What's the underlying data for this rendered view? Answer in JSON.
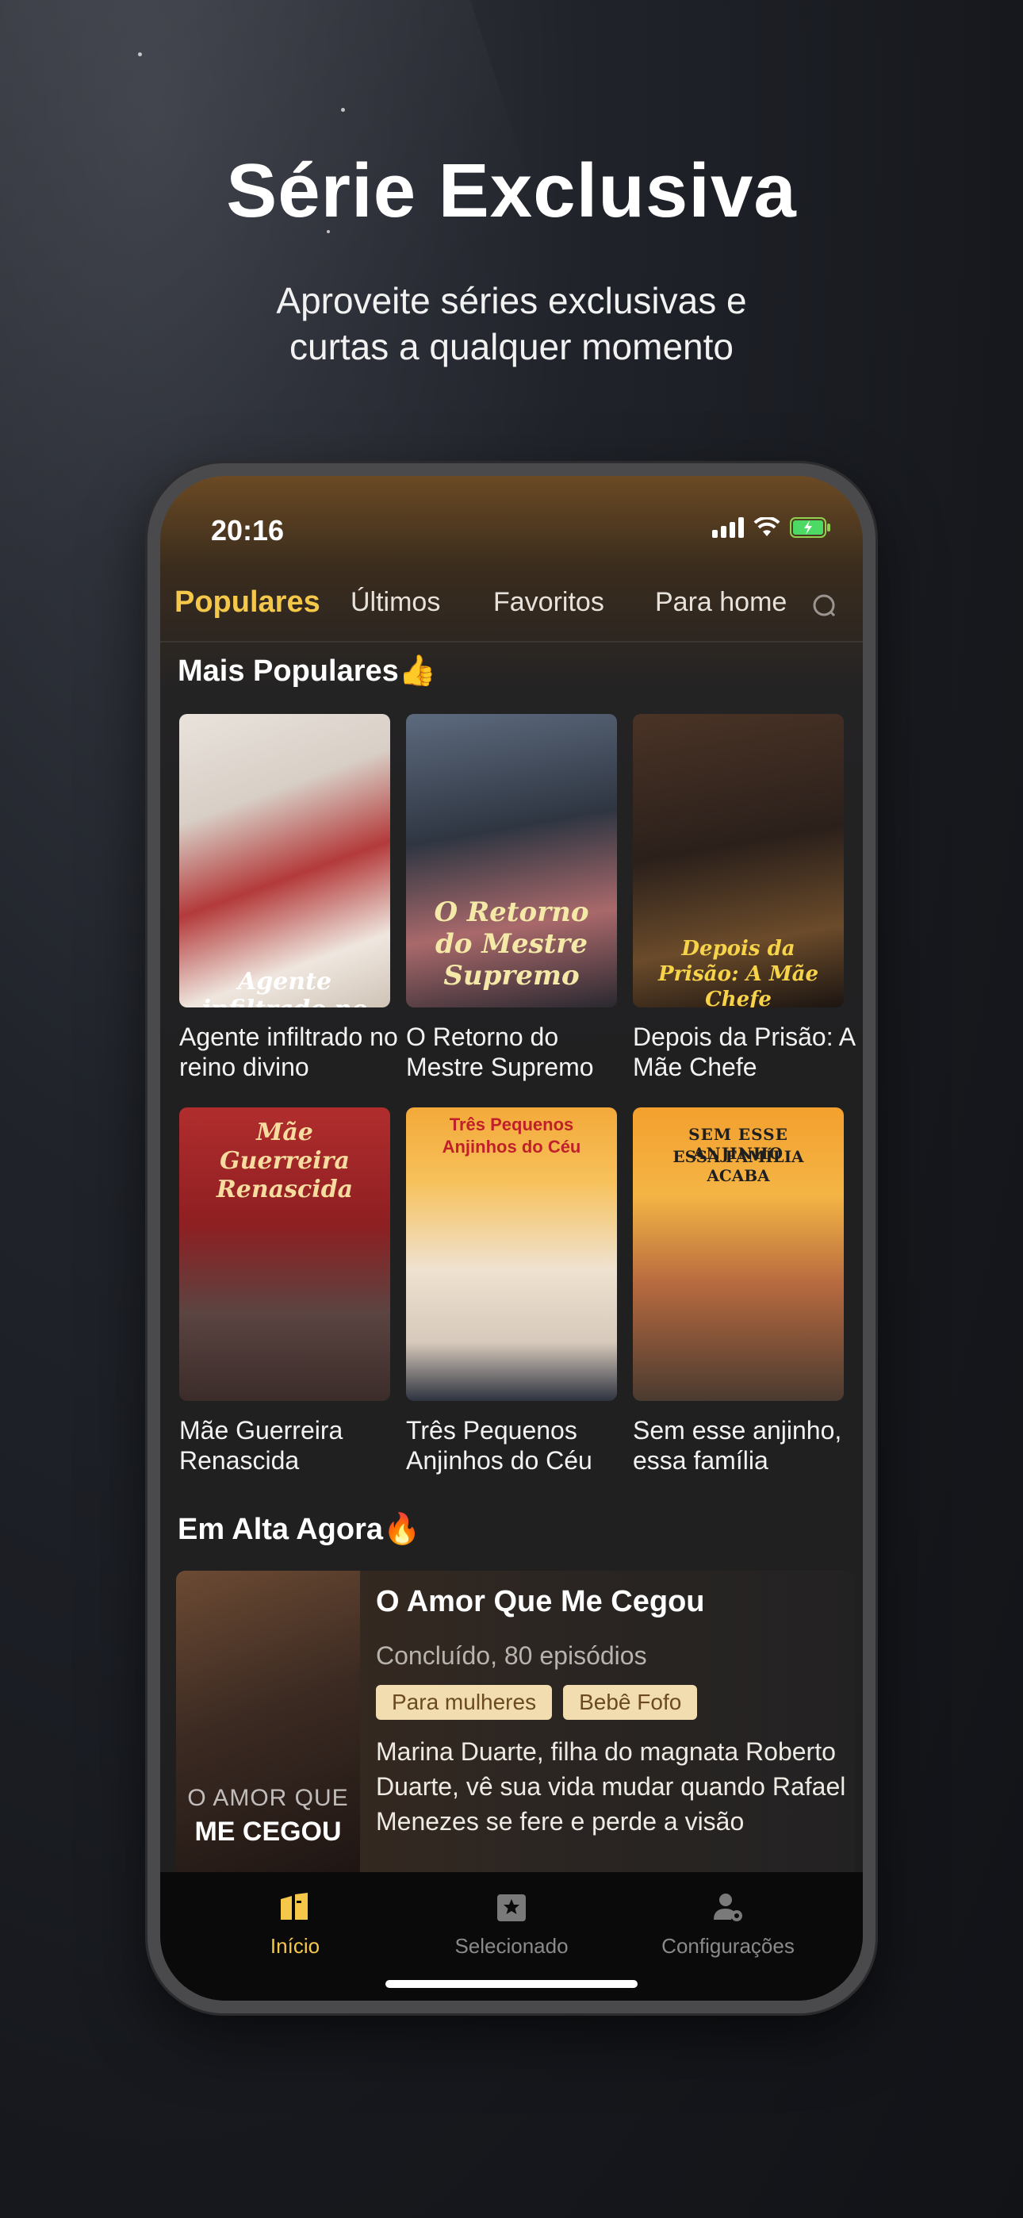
{
  "hero": {
    "title": "Série Exclusiva",
    "subtitle_line1": "Aproveite séries exclusivas e",
    "subtitle_line2": "curtas a qualquer momento"
  },
  "status_bar": {
    "time": "20:16",
    "icons": [
      "signal-icon",
      "wifi-icon",
      "battery-charging-icon"
    ]
  },
  "tabs": [
    {
      "label": "Populares",
      "active": true
    },
    {
      "label": "Últimos"
    },
    {
      "label": "Favoritos"
    },
    {
      "label": "Para home"
    }
  ],
  "sections": {
    "popular_title": "Mais Populares👍",
    "trending_title": "Em Alta Agora🔥"
  },
  "popular": [
    {
      "label": "Agente infiltrado no reino divino",
      "poster_text": "Agente infiltrado no"
    },
    {
      "label": "O Retorno do Mestre Supremo",
      "poster_text": "O Retorno do Mestre Supremo"
    },
    {
      "label": "Depois da Prisão: A Mãe Chefe",
      "poster_text": "Depois da Prisão: A Mãe Chefe Impressionante"
    },
    {
      "label": "Mãe Guerreira Renascida",
      "poster_text": "Mãe Guerreira Renascida"
    },
    {
      "label": "Três Pequenos Anjinhos do Céu",
      "poster_text": "Três Pequenos Anjinhos do Céu"
    },
    {
      "label": "Sem esse anjinho, essa família",
      "poster_text_1": "SEM ESSE ANJINHO",
      "poster_text_2": "ESSA FAMÍLIA ACABA"
    }
  ],
  "featured": {
    "title": "O Amor Que Me Cegou",
    "meta": "Concluído, 80 episódios",
    "tags": [
      "Para mulheres",
      "Bebê Fofo"
    ],
    "description": "Marina Duarte, filha do magnata Roberto Duarte, vê sua vida mudar quando Rafael Menezes se fere e perde a visão",
    "poster_text_1": "O AMOR QUE",
    "poster_text_2": "ME CEGOU"
  },
  "tabbar": [
    {
      "label": "Início",
      "active": true,
      "icon": "home-book-icon"
    },
    {
      "label": "Selecionado",
      "icon": "selected-star-icon"
    },
    {
      "label": "Configurações",
      "icon": "user-settings-icon"
    }
  ],
  "colors": {
    "accent": "#f6c84a",
    "tag_bg": "#f2ddb0",
    "tabbar_bg": "#0a0a0a"
  }
}
